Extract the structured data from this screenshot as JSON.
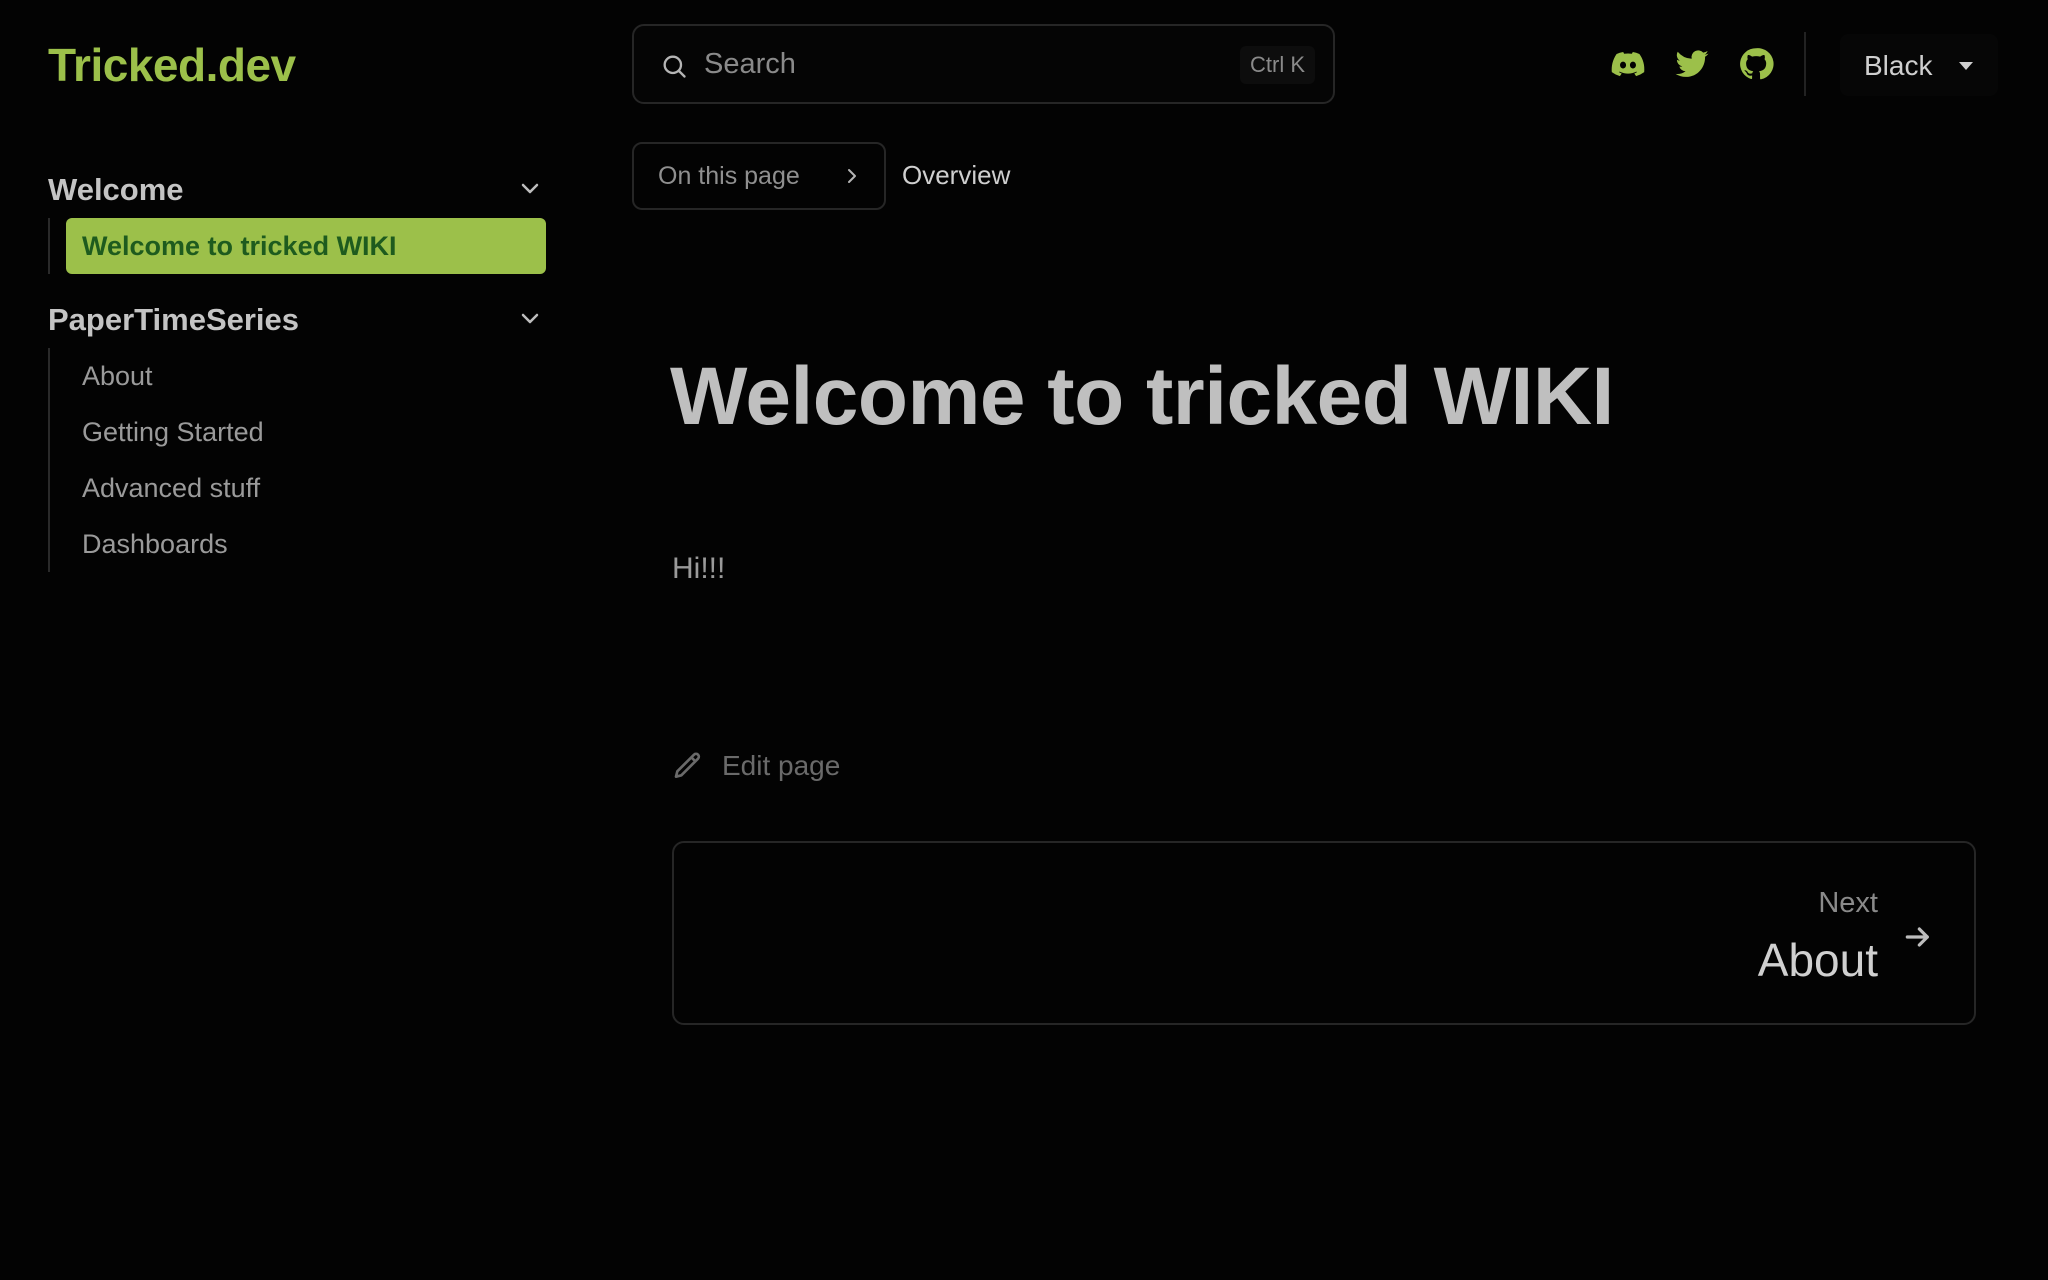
{
  "brand": {
    "name": "Tricked.dev"
  },
  "sidebar": {
    "sections": [
      {
        "title": "Welcome",
        "items": [
          {
            "label": "Welcome to tricked WIKI",
            "active": true
          }
        ]
      },
      {
        "title": "PaperTimeSeries",
        "items": [
          {
            "label": "About"
          },
          {
            "label": "Getting Started"
          },
          {
            "label": "Advanced stuff"
          },
          {
            "label": "Dashboards"
          }
        ]
      }
    ]
  },
  "header": {
    "search": {
      "placeholder": "Search",
      "shortcut": "Ctrl K"
    },
    "social_icons": [
      "discord-icon",
      "twitter-icon",
      "github-icon"
    ],
    "theme": {
      "selected": "Black"
    }
  },
  "toc": {
    "button_label": "On this page",
    "current": "Overview"
  },
  "content": {
    "title": "Welcome to tricked WIKI",
    "body": "Hi!!!",
    "edit_label": "Edit page"
  },
  "pager": {
    "next_label": "Next",
    "next_title": "About"
  },
  "colors": {
    "accent": "#9cc04a",
    "active_text": "#1e5b1e",
    "background": "#030303"
  }
}
